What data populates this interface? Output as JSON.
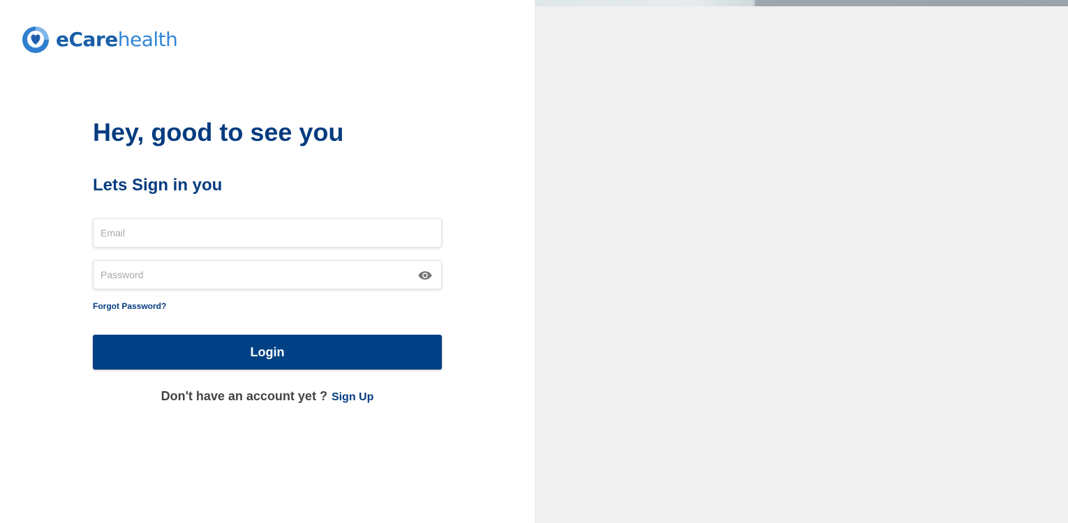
{
  "brand": {
    "word1": "eCare",
    "word2": "health",
    "colors": {
      "dark_blue": "#1a5fa8",
      "light_blue": "#2e86d6"
    }
  },
  "login": {
    "heading": "Hey, good to see you",
    "subheading": "Lets Sign in you",
    "email_placeholder": "Email",
    "password_placeholder": "Password",
    "password_toggle_icon": "eye-icon",
    "forgot_password": "Forgot Password?",
    "login_button": "Login",
    "signup_prompt": "Don't have an account yet ?",
    "signup_link": "Sign Up"
  },
  "colors": {
    "primary": "#004085",
    "heading": "#043c80",
    "right_panel_bg": "#f0f0f0"
  }
}
